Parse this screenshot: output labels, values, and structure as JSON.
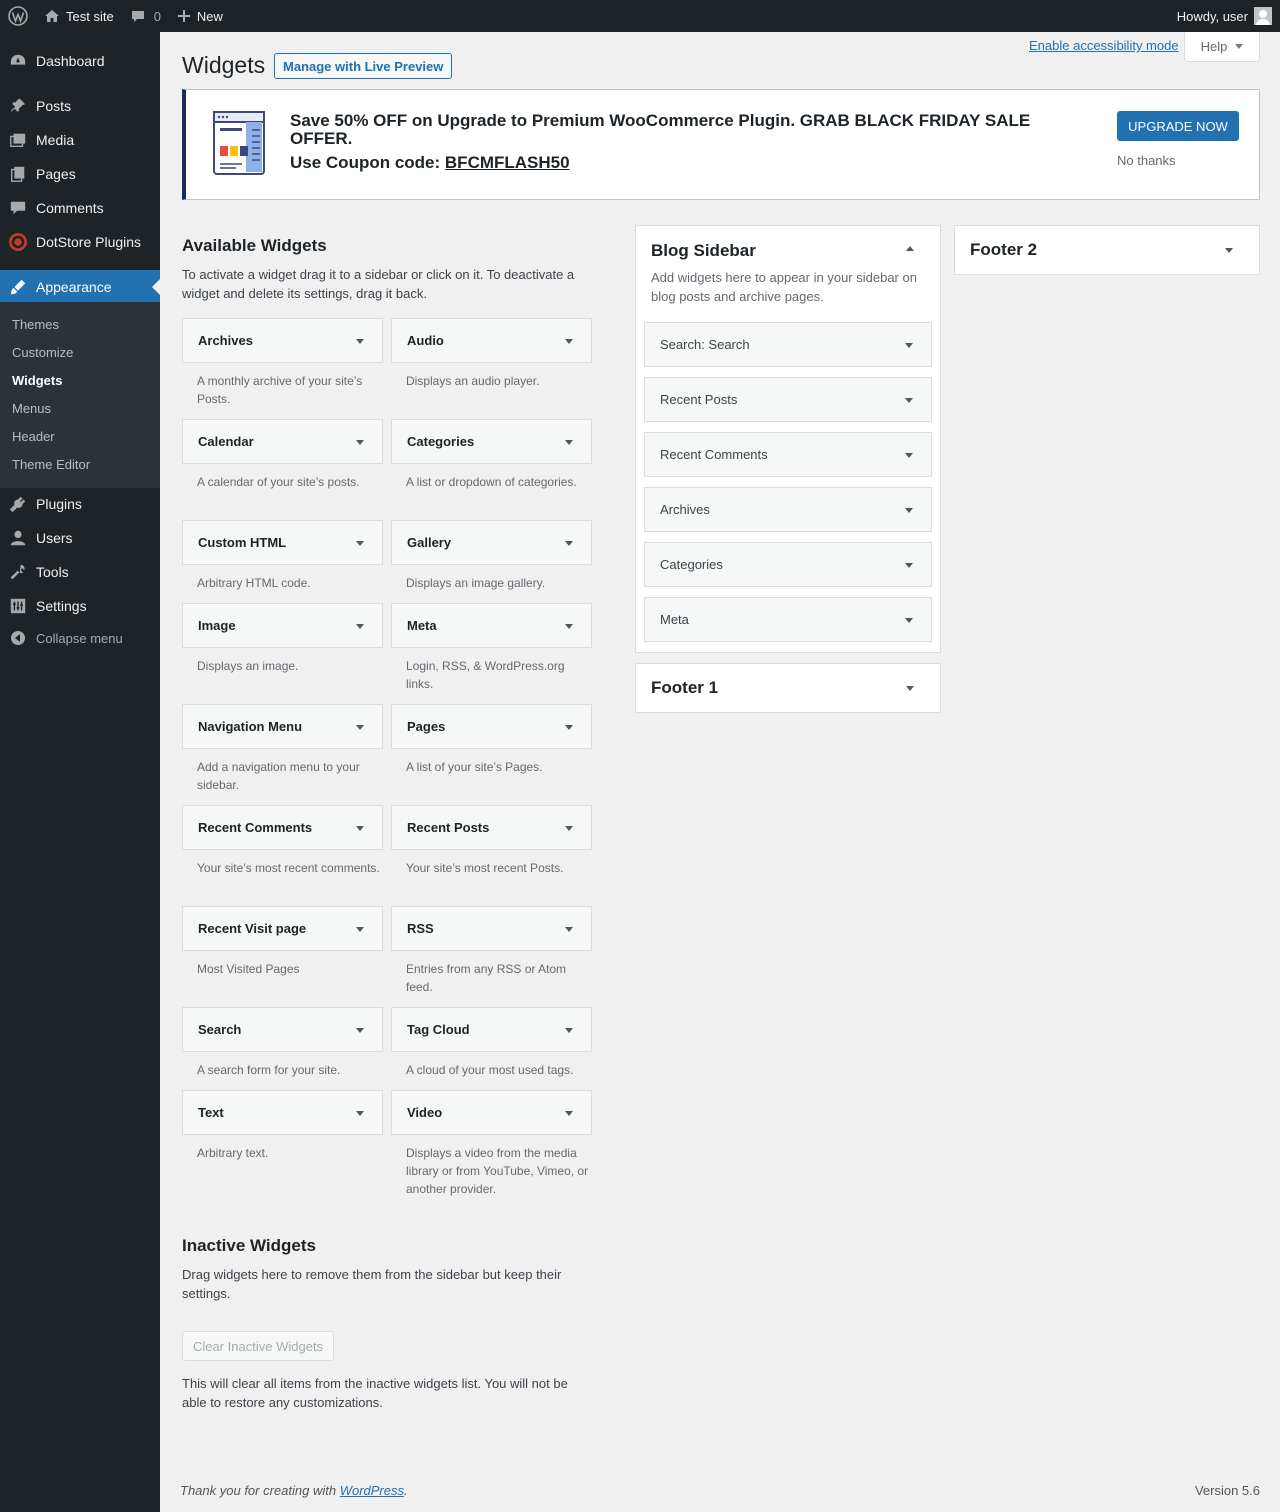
{
  "admin_bar": {
    "site_name": "Test site",
    "comments_count": "0",
    "new_label": "New",
    "howdy": "Howdy, user"
  },
  "menu": {
    "items": [
      {
        "label": "Dashboard",
        "icon": "dashboard-icon"
      },
      {
        "label": "Posts",
        "icon": "pin-icon"
      },
      {
        "label": "Media",
        "icon": "media-icon"
      },
      {
        "label": "Pages",
        "icon": "pages-icon"
      },
      {
        "label": "Comments",
        "icon": "comment-icon"
      },
      {
        "label": "DotStore Plugins",
        "icon": "dotstore-icon"
      },
      {
        "label": "Appearance",
        "icon": "brush-icon"
      },
      {
        "label": "Plugins",
        "icon": "plugin-icon"
      },
      {
        "label": "Users",
        "icon": "users-icon"
      },
      {
        "label": "Tools",
        "icon": "wrench-icon"
      },
      {
        "label": "Settings",
        "icon": "settings-icon"
      }
    ],
    "submenu": [
      "Themes",
      "Customize",
      "Widgets",
      "Menus",
      "Header",
      "Theme Editor"
    ],
    "collapse_label": "Collapse menu"
  },
  "header": {
    "accessibility_link": "Enable accessibility mode",
    "help_label": "Help",
    "title": "Widgets",
    "live_preview_button": "Manage with Live Preview"
  },
  "notice": {
    "headline": "Save 50% OFF on Upgrade to Premium WooCommerce Plugin. GRAB BLACK FRIDAY SALE OFFER.",
    "coupon_prefix": "Use Coupon code:",
    "coupon_code": "BFCMFLASH50",
    "upgrade_button": "UPGRADE NOW",
    "dismiss_link": "No thanks"
  },
  "available": {
    "title": "Available Widgets",
    "description": "To activate a widget drag it to a sidebar or click on it. To deactivate a widget and delete its settings, drag it back.",
    "widgets": [
      {
        "title": "Archives",
        "desc": "A monthly archive of your site’s Posts."
      },
      {
        "title": "Audio",
        "desc": "Displays an audio player."
      },
      {
        "title": "Calendar",
        "desc": "A calendar of your site’s posts."
      },
      {
        "title": "Categories",
        "desc": "A list or dropdown of categories."
      },
      {
        "title": "Custom HTML",
        "desc": "Arbitrary HTML code."
      },
      {
        "title": "Gallery",
        "desc": "Displays an image gallery."
      },
      {
        "title": "Image",
        "desc": "Displays an image."
      },
      {
        "title": "Meta",
        "desc": "Login, RSS, & WordPress.org links."
      },
      {
        "title": "Navigation Menu",
        "desc": "Add a navigation menu to your sidebar."
      },
      {
        "title": "Pages",
        "desc": "A list of your site’s Pages."
      },
      {
        "title": "Recent Comments",
        "desc": "Your site’s most recent comments."
      },
      {
        "title": "Recent Posts",
        "desc": "Your site’s most recent Posts."
      },
      {
        "title": "Recent Visit page",
        "desc": "Most Visited Pages"
      },
      {
        "title": "RSS",
        "desc": "Entries from any RSS or Atom feed."
      },
      {
        "title": "Search",
        "desc": "A search form for your site."
      },
      {
        "title": "Tag Cloud",
        "desc": "A cloud of your most used tags."
      },
      {
        "title": "Text",
        "desc": "Arbitrary text."
      },
      {
        "title": "Video",
        "desc": "Displays a video from the media library or from YouTube, Vimeo, or another provider."
      }
    ]
  },
  "blog_sidebar": {
    "title": "Blog Sidebar",
    "description": "Add widgets here to appear in your sidebar on blog posts and archive pages.",
    "widgets": [
      {
        "title": "Search",
        "subtitle": ": Search"
      },
      {
        "title": "Recent Posts",
        "subtitle": ""
      },
      {
        "title": "Recent Comments",
        "subtitle": ""
      },
      {
        "title": "Archives",
        "subtitle": ""
      },
      {
        "title": "Categories",
        "subtitle": ""
      },
      {
        "title": "Meta",
        "subtitle": ""
      }
    ]
  },
  "footer1": {
    "title": "Footer 1"
  },
  "footer2": {
    "title": "Footer 2"
  },
  "inactive": {
    "title": "Inactive Widgets",
    "description": "Drag widgets here to remove them from the sidebar but keep their settings.",
    "clear_button": "Clear Inactive Widgets",
    "clear_note": "This will clear all items from the inactive widgets list. You will not be able to restore any customizations."
  },
  "footer": {
    "thanks_prefix": "Thank you for creating with",
    "wordpress_link": "WordPress",
    "thanks_suffix": ".",
    "version": "Version 5.6"
  },
  "colors": {
    "admin_dark": "#1d2327",
    "accent_blue": "#2271b1",
    "submenu_bg": "#2c3338",
    "page_bg": "#f0f0f1",
    "notice_border": "#1d2a5b"
  }
}
